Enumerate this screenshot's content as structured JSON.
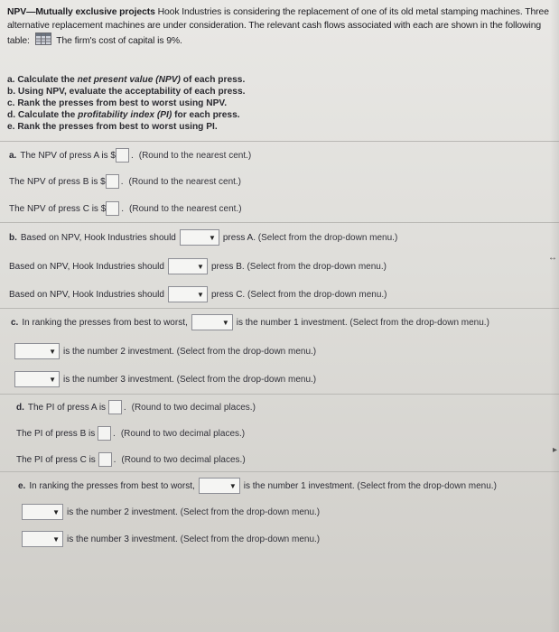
{
  "intro": {
    "title": "NPV—Mutually exclusive projects",
    "text1": " Hook Industries is considering the replacement of one of its old metal stamping machines. Three alternative replacement machines are under consideration. The relevant cash flows associated with each are shown in the following table:",
    "text2": " The firm's cost of capital is 9%."
  },
  "tasks": [
    {
      "prefix": "a. Calculate the ",
      "em": "net present value (NPV)",
      "suffix": " of each press."
    },
    {
      "prefix": "b. Using NPV, evaluate the acceptability of each press.",
      "em": "",
      "suffix": ""
    },
    {
      "prefix": "c. Rank the presses from best to worst using NPV.",
      "em": "",
      "suffix": ""
    },
    {
      "prefix": "d. Calculate the ",
      "em": "profitability index (PI)",
      "suffix": " for each press."
    },
    {
      "prefix": "e. Rank the presses from best to worst using PI.",
      "em": "",
      "suffix": ""
    }
  ],
  "npv": {
    "a_label": "a.",
    "rows": [
      {
        "text": "The NPV of press A is $",
        "hint": "(Round to the nearest cent.)"
      },
      {
        "text": "The NPV of press B is $",
        "hint": "(Round to the nearest cent.)"
      },
      {
        "text": "The NPV of press C is $",
        "hint": "(Round to the nearest cent.)"
      }
    ]
  },
  "accept": {
    "b_label": "b.",
    "rows": [
      {
        "text": "Based on NPV, Hook Industries should",
        "after": "press A.",
        "hint": "(Select from the drop-down menu.)"
      },
      {
        "text": "Based on NPV, Hook Industries should",
        "after": "press B.",
        "hint": "(Select from the drop-down menu.)"
      },
      {
        "text": "Based on NPV, Hook Industries should",
        "after": "press C.",
        "hint": "(Select from the drop-down menu.)"
      }
    ]
  },
  "rank_npv": {
    "c_label": "c.",
    "lead": "In ranking the presses from best to worst,",
    "rows": [
      {
        "text": "is the number 1 investment.",
        "hint": "(Select from the drop-down menu.)"
      },
      {
        "text": "is the number 2 investment.",
        "hint": "(Select from the drop-down menu.)"
      },
      {
        "text": "is the number 3 investment.",
        "hint": "(Select from the drop-down menu.)"
      }
    ]
  },
  "pi": {
    "d_label": "d.",
    "rows": [
      {
        "text": "The PI of press A is",
        "hint": "(Round to two decimal places.)"
      },
      {
        "text": "The PI of press B is",
        "hint": "(Round to two decimal places.)"
      },
      {
        "text": "The PI of press C is",
        "hint": "(Round to two decimal places.)"
      }
    ]
  },
  "rank_pi": {
    "e_label": "e.",
    "lead": "In ranking the presses from best to worst,",
    "rows": [
      {
        "text": "is the number 1 investment.",
        "hint": "(Select from the drop-down menu.)"
      },
      {
        "text": "is the number 2 investment.",
        "hint": "(Select from the drop-down menu.)"
      },
      {
        "text": "is the number 3 investment.",
        "hint": "(Select from the drop-down menu.)"
      }
    ]
  },
  "icons": {
    "dropdown_arrow": "▼"
  }
}
